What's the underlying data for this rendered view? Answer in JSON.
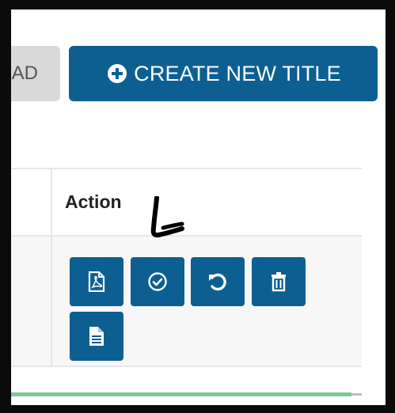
{
  "toolbar": {
    "upload_label_partial": "AD",
    "create_label": "CREATE NEW TITLE"
  },
  "table": {
    "action_header": "Action"
  },
  "icons": {
    "create": "plus-circle-icon",
    "actions": [
      "pdf-file-icon",
      "check-circle-icon",
      "undo-icon",
      "trash-icon",
      "document-icon"
    ]
  },
  "progress": {
    "value": 0.97
  },
  "colors": {
    "primary": "#0d5f91",
    "secondary_button": "#d9d9d9",
    "progress": "#7fc79a",
    "frame": "#0b0b0b"
  }
}
